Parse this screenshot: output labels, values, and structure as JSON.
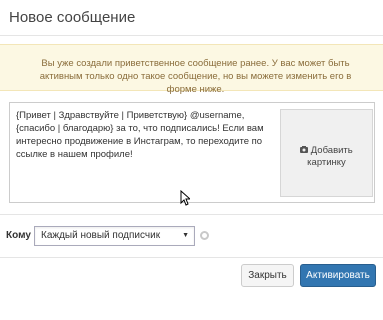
{
  "header": {
    "title": "Новое сообщение"
  },
  "notice": {
    "text": "Вы уже создали приветственное сообщение ранее. У вас может быть активным только одно такое сообщение, но вы можете изменить его в форме ниже."
  },
  "message": {
    "text": "{Привет | Здравствуйте | Приветствую} @username, {спасибо | благодарю} за то, что подписались! Если вам интересно продвижение в Инстаграм, то переходите по ссылке в нашем профиле!"
  },
  "add_image": {
    "icon": "camera-icon",
    "label": "Добавить картинку"
  },
  "recipient": {
    "label": "Кому",
    "selected": "Каждый новый подписчик"
  },
  "buttons": {
    "close": "Закрыть",
    "activate": "Активировать"
  },
  "colors": {
    "primary": "#3276b1",
    "notice_bg": "#fcf8e3",
    "notice_text": "#8a6d3b"
  }
}
